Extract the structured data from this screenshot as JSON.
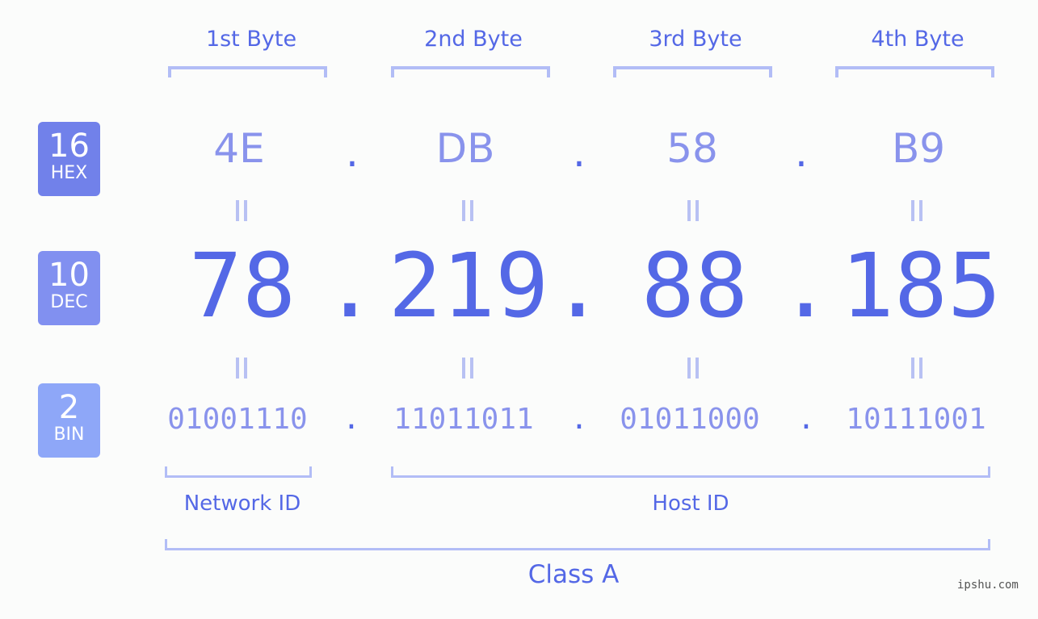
{
  "byte_headers": [
    "1st Byte",
    "2nd Byte",
    "3rd Byte",
    "4th Byte"
  ],
  "rows": {
    "hex": {
      "badge_num": "16",
      "badge_label": "HEX",
      "values": [
        "4E",
        "DB",
        "58",
        "B9"
      ],
      "color": "#7181ea"
    },
    "dec": {
      "badge_num": "10",
      "badge_label": "DEC",
      "values": [
        "78",
        "219",
        "88",
        "185"
      ],
      "color": "#8190f0"
    },
    "bin": {
      "badge_num": "2",
      "badge_label": "BIN",
      "values": [
        "01001110",
        "11011011",
        "01011000",
        "10111001"
      ],
      "color": "#8ea7f8"
    }
  },
  "separator": ".",
  "network_label": "Network ID",
  "host_label": "Host ID",
  "class_label": "Class A",
  "watermark": "ipshu.com"
}
